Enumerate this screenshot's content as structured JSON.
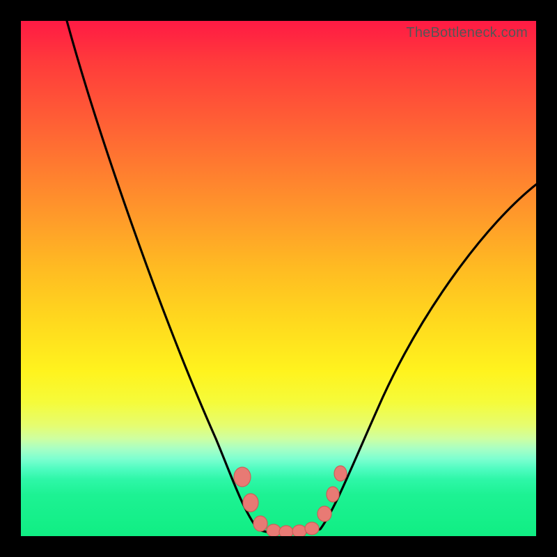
{
  "watermark": "TheBottleneck.com",
  "colors": {
    "dot_fill": "#e87a74",
    "dot_stroke": "#cc5f58",
    "curve_stroke": "#000000"
  },
  "chart_data": {
    "type": "line",
    "title": "",
    "xlabel": "",
    "ylabel": "",
    "xlim": [
      0,
      100
    ],
    "ylim": [
      0,
      100
    ],
    "note": "Axes are unlabeled in the source image; values below are normalized estimates read from pixel positions (0–100 each axis, y increases upward).",
    "series": [
      {
        "name": "left-descending",
        "x": [
          9,
          12,
          16,
          20,
          24,
          28,
          32,
          35,
          38,
          40,
          42,
          44,
          46
        ],
        "y": [
          100,
          92,
          82,
          72,
          62,
          52,
          42,
          33,
          25,
          18,
          12,
          6,
          1
        ]
      },
      {
        "name": "valley-floor",
        "x": [
          46,
          49,
          52,
          55,
          58
        ],
        "y": [
          0.8,
          0.4,
          0.3,
          0.4,
          0.8
        ]
      },
      {
        "name": "right-ascending",
        "x": [
          58,
          61,
          65,
          70,
          76,
          83,
          91,
          100
        ],
        "y": [
          1,
          6,
          15,
          26,
          38,
          50,
          60,
          68
        ]
      }
    ],
    "markers": {
      "name": "salmon-dots",
      "points": [
        {
          "x": 43.0,
          "y": 11.0,
          "r": 1.6
        },
        {
          "x": 44.5,
          "y": 6.0,
          "r": 1.4
        },
        {
          "x": 46.5,
          "y": 2.0,
          "r": 1.3
        },
        {
          "x": 49.0,
          "y": 0.8,
          "r": 1.3
        },
        {
          "x": 51.5,
          "y": 0.6,
          "r": 1.3
        },
        {
          "x": 54.0,
          "y": 0.7,
          "r": 1.3
        },
        {
          "x": 56.5,
          "y": 1.2,
          "r": 1.3
        },
        {
          "x": 59.0,
          "y": 4.0,
          "r": 1.3
        },
        {
          "x": 60.5,
          "y": 8.0,
          "r": 1.2
        },
        {
          "x": 62.0,
          "y": 12.0,
          "r": 1.2
        }
      ]
    }
  }
}
